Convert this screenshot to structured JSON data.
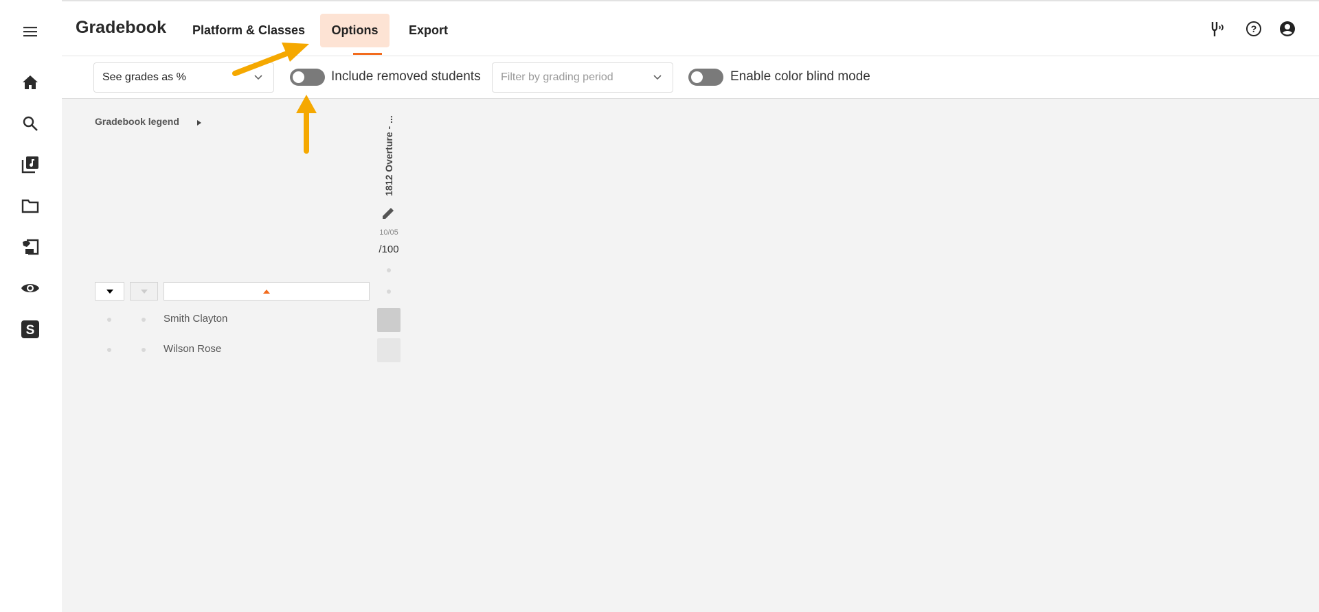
{
  "app": {
    "title": "Gradebook"
  },
  "tabs": [
    {
      "label": "Platform & Classes"
    },
    {
      "label": "Options",
      "active": true
    },
    {
      "label": "Export"
    }
  ],
  "header_icons": [
    "tuning-fork-icon",
    "help-icon",
    "account-icon"
  ],
  "sidebar": {
    "items": [
      "menu-icon",
      "home-icon",
      "search-icon",
      "music-library-icon",
      "folder-icon",
      "assignment-icon",
      "eye-icon",
      "s-logo-icon"
    ]
  },
  "toolbar": {
    "grade_view": {
      "value": "See grades as %"
    },
    "include_removed": {
      "label": "Include removed students",
      "on": false
    },
    "grading_period": {
      "placeholder": "Filter by grading period"
    },
    "color_blind": {
      "label": "Enable color blind mode",
      "on": false
    }
  },
  "legend": {
    "label": "Gradebook legend"
  },
  "assignment": {
    "title": "1812 Overture - ...",
    "date": "10/05",
    "points": "/100"
  },
  "students": [
    {
      "name": "Smith Clayton",
      "cell_color": "#cccccc"
    },
    {
      "name": "Wilson Rose",
      "cell_color": "#e6e6e6"
    }
  ],
  "colors": {
    "accent": "#f26b1d",
    "active_tab_bg": "#fde3d4",
    "annotation": "#f5a800"
  }
}
